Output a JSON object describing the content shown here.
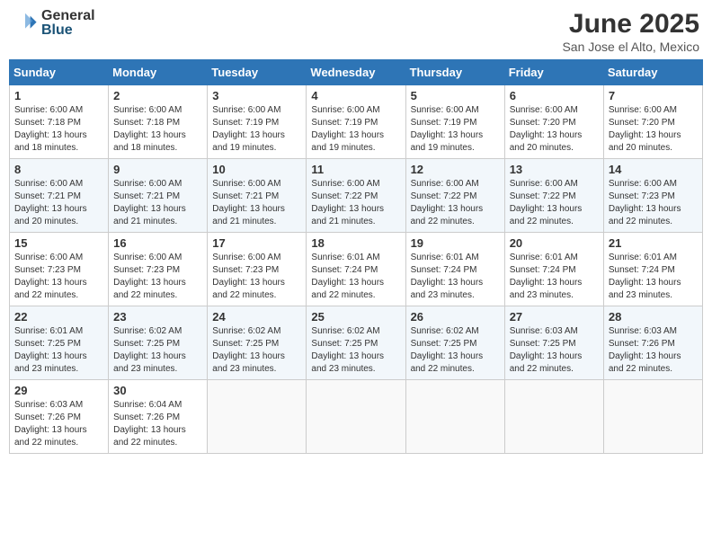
{
  "logo": {
    "general": "General",
    "blue": "Blue"
  },
  "title": "June 2025",
  "location": "San Jose el Alto, Mexico",
  "days_of_week": [
    "Sunday",
    "Monday",
    "Tuesday",
    "Wednesday",
    "Thursday",
    "Friday",
    "Saturday"
  ],
  "weeks": [
    [
      {
        "day": "1",
        "sunrise": "6:00 AM",
        "sunset": "7:18 PM",
        "daylight": "13 hours and 18 minutes."
      },
      {
        "day": "2",
        "sunrise": "6:00 AM",
        "sunset": "7:18 PM",
        "daylight": "13 hours and 18 minutes."
      },
      {
        "day": "3",
        "sunrise": "6:00 AM",
        "sunset": "7:19 PM",
        "daylight": "13 hours and 19 minutes."
      },
      {
        "day": "4",
        "sunrise": "6:00 AM",
        "sunset": "7:19 PM",
        "daylight": "13 hours and 19 minutes."
      },
      {
        "day": "5",
        "sunrise": "6:00 AM",
        "sunset": "7:19 PM",
        "daylight": "13 hours and 19 minutes."
      },
      {
        "day": "6",
        "sunrise": "6:00 AM",
        "sunset": "7:20 PM",
        "daylight": "13 hours and 20 minutes."
      },
      {
        "day": "7",
        "sunrise": "6:00 AM",
        "sunset": "7:20 PM",
        "daylight": "13 hours and 20 minutes."
      }
    ],
    [
      {
        "day": "8",
        "sunrise": "6:00 AM",
        "sunset": "7:21 PM",
        "daylight": "13 hours and 20 minutes."
      },
      {
        "day": "9",
        "sunrise": "6:00 AM",
        "sunset": "7:21 PM",
        "daylight": "13 hours and 21 minutes."
      },
      {
        "day": "10",
        "sunrise": "6:00 AM",
        "sunset": "7:21 PM",
        "daylight": "13 hours and 21 minutes."
      },
      {
        "day": "11",
        "sunrise": "6:00 AM",
        "sunset": "7:22 PM",
        "daylight": "13 hours and 21 minutes."
      },
      {
        "day": "12",
        "sunrise": "6:00 AM",
        "sunset": "7:22 PM",
        "daylight": "13 hours and 22 minutes."
      },
      {
        "day": "13",
        "sunrise": "6:00 AM",
        "sunset": "7:22 PM",
        "daylight": "13 hours and 22 minutes."
      },
      {
        "day": "14",
        "sunrise": "6:00 AM",
        "sunset": "7:23 PM",
        "daylight": "13 hours and 22 minutes."
      }
    ],
    [
      {
        "day": "15",
        "sunrise": "6:00 AM",
        "sunset": "7:23 PM",
        "daylight": "13 hours and 22 minutes."
      },
      {
        "day": "16",
        "sunrise": "6:00 AM",
        "sunset": "7:23 PM",
        "daylight": "13 hours and 22 minutes."
      },
      {
        "day": "17",
        "sunrise": "6:00 AM",
        "sunset": "7:23 PM",
        "daylight": "13 hours and 22 minutes."
      },
      {
        "day": "18",
        "sunrise": "6:01 AM",
        "sunset": "7:24 PM",
        "daylight": "13 hours and 22 minutes."
      },
      {
        "day": "19",
        "sunrise": "6:01 AM",
        "sunset": "7:24 PM",
        "daylight": "13 hours and 23 minutes."
      },
      {
        "day": "20",
        "sunrise": "6:01 AM",
        "sunset": "7:24 PM",
        "daylight": "13 hours and 23 minutes."
      },
      {
        "day": "21",
        "sunrise": "6:01 AM",
        "sunset": "7:24 PM",
        "daylight": "13 hours and 23 minutes."
      }
    ],
    [
      {
        "day": "22",
        "sunrise": "6:01 AM",
        "sunset": "7:25 PM",
        "daylight": "13 hours and 23 minutes."
      },
      {
        "day": "23",
        "sunrise": "6:02 AM",
        "sunset": "7:25 PM",
        "daylight": "13 hours and 23 minutes."
      },
      {
        "day": "24",
        "sunrise": "6:02 AM",
        "sunset": "7:25 PM",
        "daylight": "13 hours and 23 minutes."
      },
      {
        "day": "25",
        "sunrise": "6:02 AM",
        "sunset": "7:25 PM",
        "daylight": "13 hours and 23 minutes."
      },
      {
        "day": "26",
        "sunrise": "6:02 AM",
        "sunset": "7:25 PM",
        "daylight": "13 hours and 22 minutes."
      },
      {
        "day": "27",
        "sunrise": "6:03 AM",
        "sunset": "7:25 PM",
        "daylight": "13 hours and 22 minutes."
      },
      {
        "day": "28",
        "sunrise": "6:03 AM",
        "sunset": "7:26 PM",
        "daylight": "13 hours and 22 minutes."
      }
    ],
    [
      {
        "day": "29",
        "sunrise": "6:03 AM",
        "sunset": "7:26 PM",
        "daylight": "13 hours and 22 minutes."
      },
      {
        "day": "30",
        "sunrise": "6:04 AM",
        "sunset": "7:26 PM",
        "daylight": "13 hours and 22 minutes."
      },
      null,
      null,
      null,
      null,
      null
    ]
  ],
  "labels": {
    "sunrise": "Sunrise:",
    "sunset": "Sunset:",
    "daylight": "Daylight:"
  }
}
